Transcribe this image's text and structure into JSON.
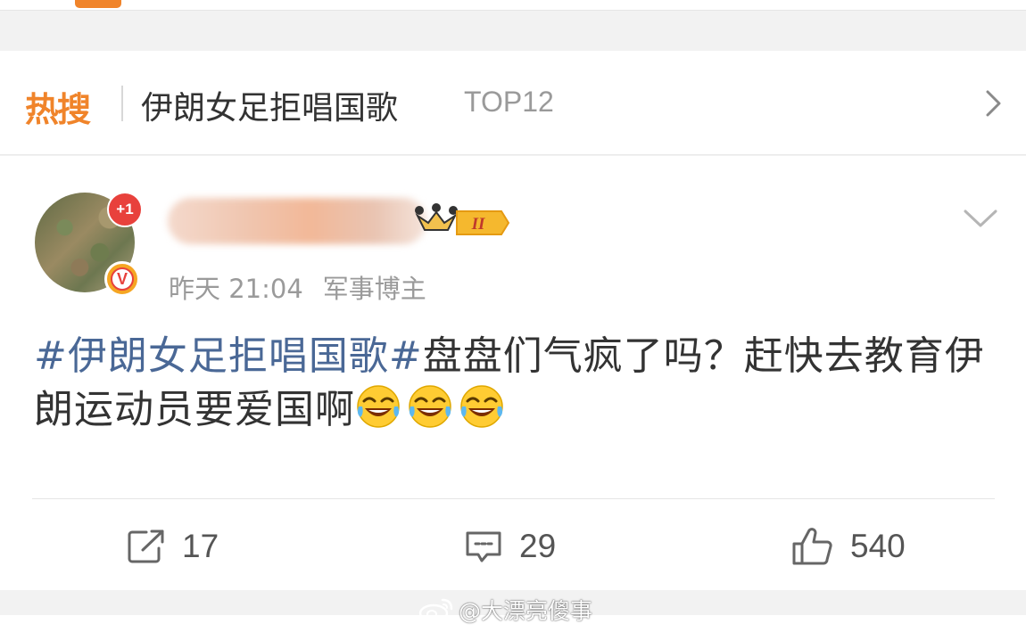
{
  "hot_search": {
    "logo_text": "热搜",
    "topic": "伊朗女足拒唱国歌",
    "rank": "TOP12"
  },
  "post": {
    "time": "昨天 21:04",
    "author_role": "军事博主",
    "badge_plus": "+1",
    "verified_mark": "V",
    "level": "II",
    "hashtag": "#伊朗女足拒唱国歌#",
    "body_text": "盘盘们气疯了吗？赶快去教育伊朗运动员要爱国啊",
    "emoji_names": [
      "laugh-cry-emoji",
      "laugh-cry-emoji",
      "laugh-cry-emoji"
    ]
  },
  "actions": {
    "repost_count": "17",
    "comment_count": "29",
    "like_count": "540"
  },
  "watermark": {
    "text": "@大漂亮傻事"
  },
  "colors": {
    "accent_orange": "#f0842a",
    "hashtag_blue": "#4a6896",
    "badge_red": "#e8413c",
    "verified_gold": "#f5a623"
  }
}
